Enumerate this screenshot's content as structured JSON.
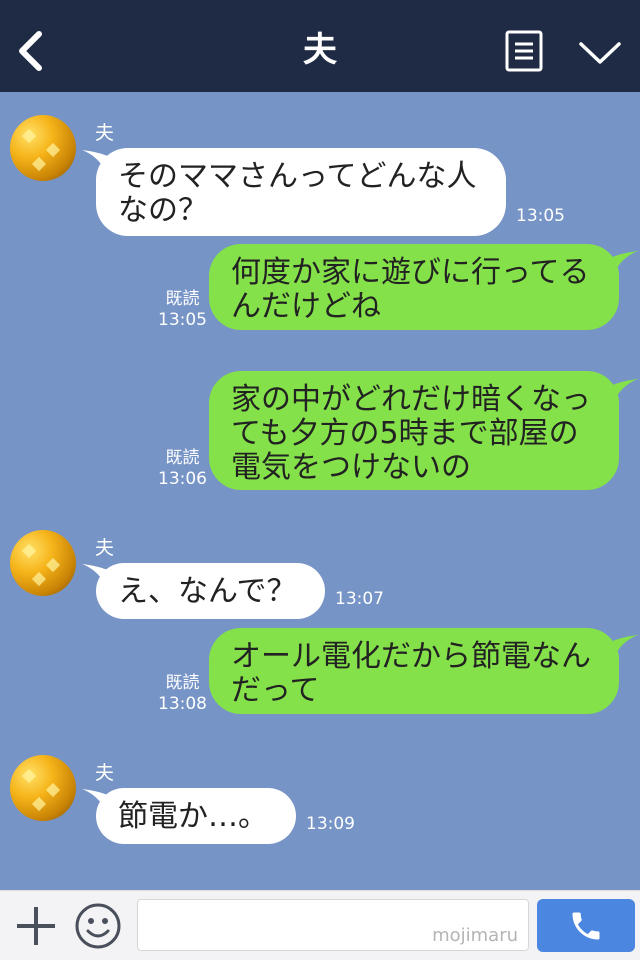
{
  "header": {
    "title": "夫",
    "icons": {
      "back": "chevron-left-icon",
      "menu": "list-icon",
      "dropdown": "chevron-down-icon"
    }
  },
  "chat": {
    "messages": [
      {
        "from": "received",
        "name": "夫",
        "text": "そのママさんってどんな人なの？",
        "time": "13:05"
      },
      {
        "from": "sent",
        "read": "既読",
        "text": "何度か家に遊びに行ってるんだけどね",
        "time": "13:05"
      },
      {
        "from": "sent",
        "read": "既読",
        "text": "家の中がどれだけ暗くなっても夕方の5時まで部屋の電気をつけないの",
        "time": "13:06"
      },
      {
        "from": "received",
        "name": "夫",
        "text": "え、なんで？",
        "time": "13:07"
      },
      {
        "from": "sent",
        "read": "既読",
        "text": "オール電化だから節電なんだって",
        "time": "13:08"
      },
      {
        "from": "received",
        "name": "夫",
        "text": "節電か…。",
        "time": "13:09"
      }
    ]
  },
  "input_bar": {
    "watermark": "mojimaru",
    "icons": {
      "add": "plus-icon",
      "emoji": "smiley-icon",
      "call": "phone-icon"
    }
  },
  "colors": {
    "header_bg": "#1f2a44",
    "chat_bg": "#7694c6",
    "sent_bubble": "#85e14a",
    "received_bubble": "#ffffff",
    "call_button": "#4b86e0"
  }
}
